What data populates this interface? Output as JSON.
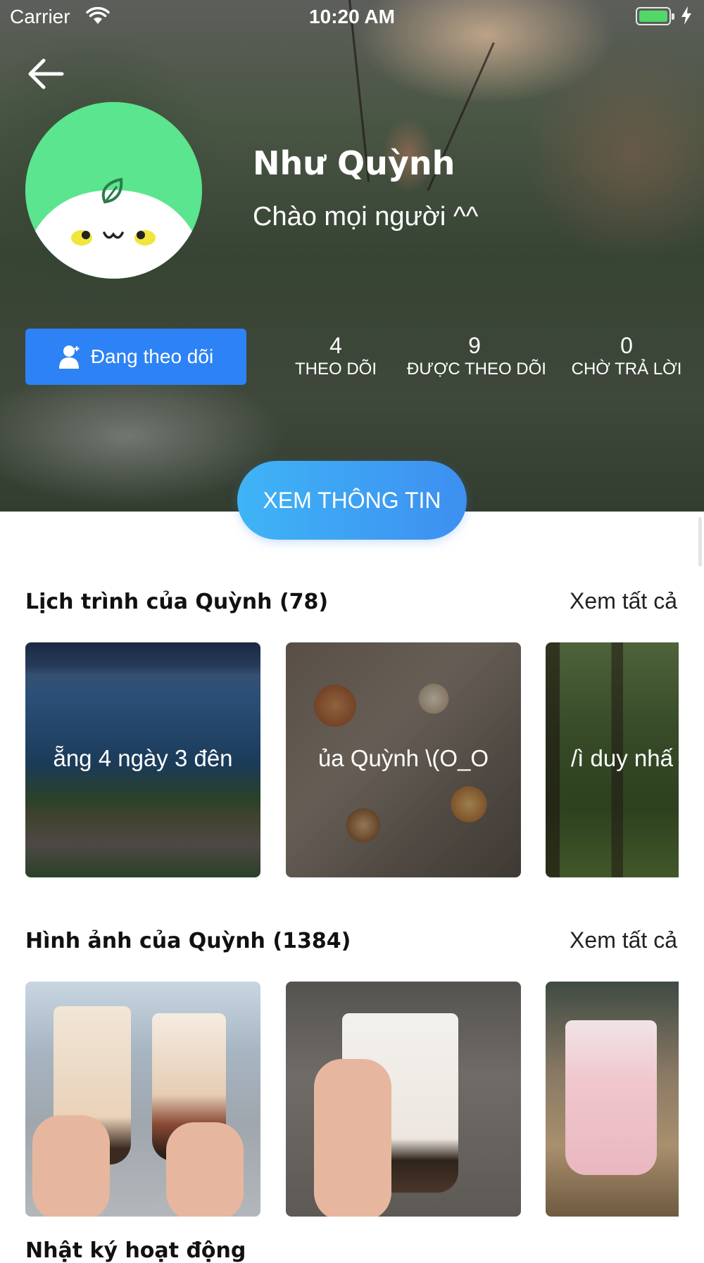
{
  "status_bar": {
    "carrier": "Carrier",
    "time": "10:20 AM",
    "battery_level": 1.0,
    "battery_color": "#53d769"
  },
  "header": {
    "back_icon": "arrow-left-icon"
  },
  "profile": {
    "name": "Như Quỳnh",
    "bio": "Chào mọi người ^^",
    "avatar_color": "#5ae58e"
  },
  "follow_button": {
    "icon": "person-check-icon",
    "label": "Đang theo dõi",
    "color": "#2d83f5"
  },
  "stats": [
    {
      "value": "4",
      "label": "THEO DÕI"
    },
    {
      "value": "9",
      "label": "ĐƯỢC THEO DÕI"
    },
    {
      "value": "0",
      "label": "CHỜ TRẢ LỜI"
    }
  ],
  "cta_button": {
    "label": "XEM THÔNG TIN"
  },
  "trips_section": {
    "title": "Lịch trình của Quỳnh (78)",
    "see_all": "Xem tất cả",
    "cards": [
      {
        "caption": "ẵng 4 ngày 3 đên"
      },
      {
        "caption": "ủa Quỳnh \\(O_O"
      },
      {
        "caption": "/ì duy nhấ"
      }
    ]
  },
  "photos_section": {
    "title": "Hình ảnh của Quỳnh (1384)",
    "see_all": "Xem tất cả"
  },
  "next_section": {
    "title": "Nhật ký hoạt động"
  }
}
